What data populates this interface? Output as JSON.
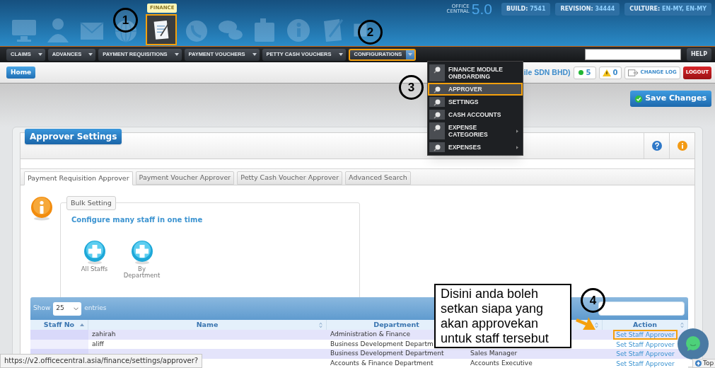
{
  "header": {
    "modules": [
      {
        "selected": false
      },
      {
        "selected": false
      },
      {
        "selected": false
      },
      {
        "selected": false
      },
      {
        "selected": true
      },
      {
        "selected": false
      },
      {
        "selected": false
      },
      {
        "selected": false
      },
      {
        "selected": false
      },
      {
        "selected": false
      },
      {
        "selected": false
      }
    ],
    "module_tooltip": "FINANCE",
    "product": {
      "name": "OFFICE CENTRAL",
      "version": "5.0"
    },
    "info_badges": [
      {
        "label": "BUILD:",
        "value": "7541"
      },
      {
        "label": "REVISION:",
        "value": "34444"
      },
      {
        "label": "CULTURE:",
        "value": "EN-MY, EN-MY"
      }
    ]
  },
  "nav": {
    "items": [
      {
        "label": "CLAIMS",
        "annotated": false
      },
      {
        "label": "ADVANCES",
        "annotated": false
      },
      {
        "label": "PAYMENT REQUISITIONS",
        "annotated": false
      },
      {
        "label": "PAYMENT VOUCHERS",
        "annotated": false
      },
      {
        "label": "PETTY CASH VOUCHERS",
        "annotated": false
      },
      {
        "label": "CONFIGURATIONS",
        "annotated": true
      }
    ],
    "help": "HELP"
  },
  "breadcrumb": {
    "home": "Home",
    "company": "ile SDN BHD)",
    "online_count": "5",
    "alert_count": "0",
    "change_log": "CHANGE LOG",
    "logout": "LOGOUT"
  },
  "dropdown": [
    {
      "label": "FINANCE MODULE ONBOARDING",
      "selected": false,
      "annotated": false,
      "has_submenu": false
    },
    {
      "label": "APPROVER",
      "selected": true,
      "annotated": true,
      "has_submenu": false
    },
    {
      "label": "SETTINGS",
      "selected": false,
      "annotated": false,
      "has_submenu": false
    },
    {
      "label": "CASH ACCOUNTS",
      "selected": false,
      "annotated": false,
      "has_submenu": false
    },
    {
      "label": "EXPENSE CATEGORIES",
      "selected": false,
      "annotated": false,
      "has_submenu": true
    },
    {
      "label": "EXPENSES",
      "selected": false,
      "annotated": false,
      "has_submenu": true
    }
  ],
  "save_button": "Save Changes",
  "panel": {
    "title": "Approver Settings",
    "tabs": [
      {
        "label": "Payment Requisition Approver",
        "selected": true
      },
      {
        "label": "Payment Voucher Approver",
        "selected": false
      },
      {
        "label": "Petty Cash Voucher Approver",
        "selected": false
      },
      {
        "label": "Advanced Search",
        "selected": false
      }
    ],
    "bulk_setting": {
      "legend": "Bulk Setting",
      "heading": "Configure many staff in one time",
      "actions": [
        {
          "label": "All Staffs"
        },
        {
          "label": "By Department"
        }
      ]
    },
    "table": {
      "show": "Show",
      "page_size": "25",
      "entries": "entries",
      "columns": [
        {
          "label": "Staff No",
          "sorted": true
        },
        {
          "label": "Name",
          "sorted": false
        },
        {
          "label": "Department",
          "sorted": false
        },
        {
          "sorted": false
        },
        {
          "label": "Action",
          "sorted": false
        }
      ],
      "rows": [
        {
          "name": "zahirah",
          "department": "Administration & Finance",
          "action": "Set Staff Approver",
          "annotated": true
        },
        {
          "name": "aliff",
          "department": "Business Development Departm",
          "action": "Set Staff Approver",
          "annotated": false
        },
        {
          "department": "Business Development Department",
          "column_4": "Sales Manager",
          "action": "Set Staff Approver",
          "annotated": false
        },
        {
          "department": "Accounts & Finance Department",
          "column_4": "Accounts Executive",
          "action": "Set Staff Approver",
          "annotated": false
        }
      ]
    }
  },
  "annotations": [
    {
      "number": "1"
    },
    {
      "number": "2"
    },
    {
      "number": "3"
    },
    {
      "number": "4"
    }
  ],
  "callout": "Disini anda boleh setkan siapa yang akan approvekan untuk staff tersebut",
  "status_url": "https://v2.officecentral.asia/finance/settings/approver?",
  "top_button": "Top"
}
